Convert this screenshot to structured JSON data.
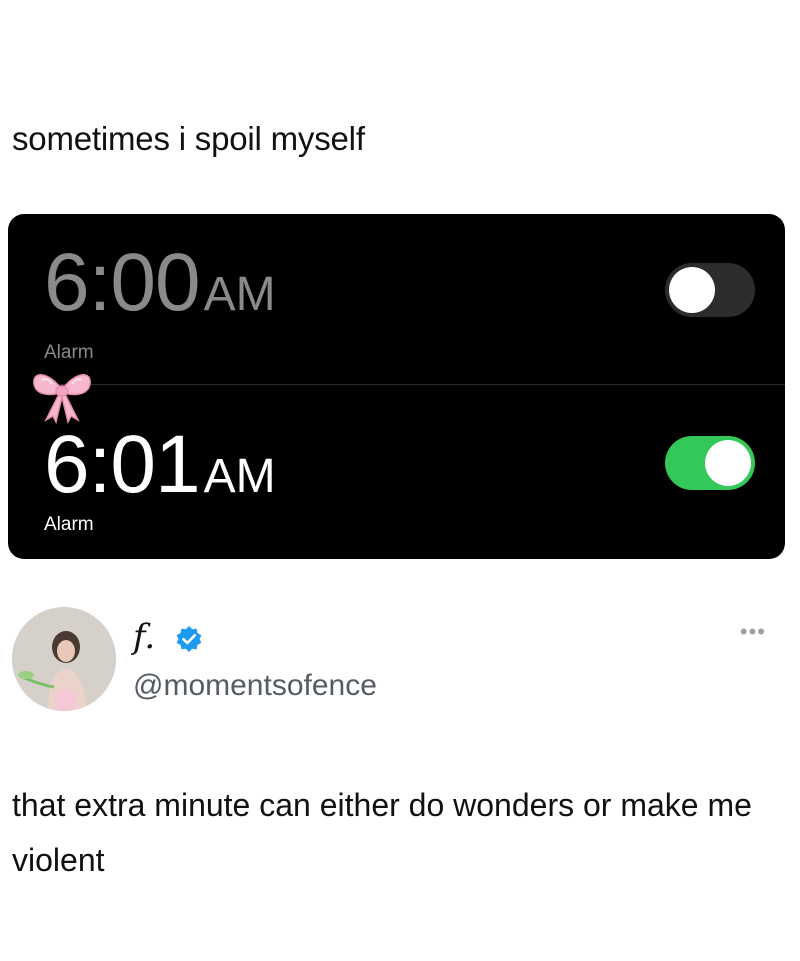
{
  "caption": "sometimes i spoil myself",
  "alarms": [
    {
      "time": "6:00",
      "ampm": "AM",
      "label": "Alarm",
      "enabled": false
    },
    {
      "time": "6:01",
      "ampm": "AM",
      "label": "Alarm",
      "enabled": true
    }
  ],
  "colors": {
    "toggle_on": "#34c759",
    "toggle_off": "#2c2c2e",
    "bow_pink": "#f7b8cf",
    "verified_blue": "#1d9bf0"
  },
  "icons": {
    "bow": "pink-ribbon-bow-icon",
    "verified": "verified-badge-icon",
    "more": "more-options-icon"
  },
  "user": {
    "display_name": "f.",
    "handle": "@momentsofence",
    "more_label": "•••"
  },
  "tweet": {
    "text": "that extra minute can either do wonders or make me violent"
  }
}
